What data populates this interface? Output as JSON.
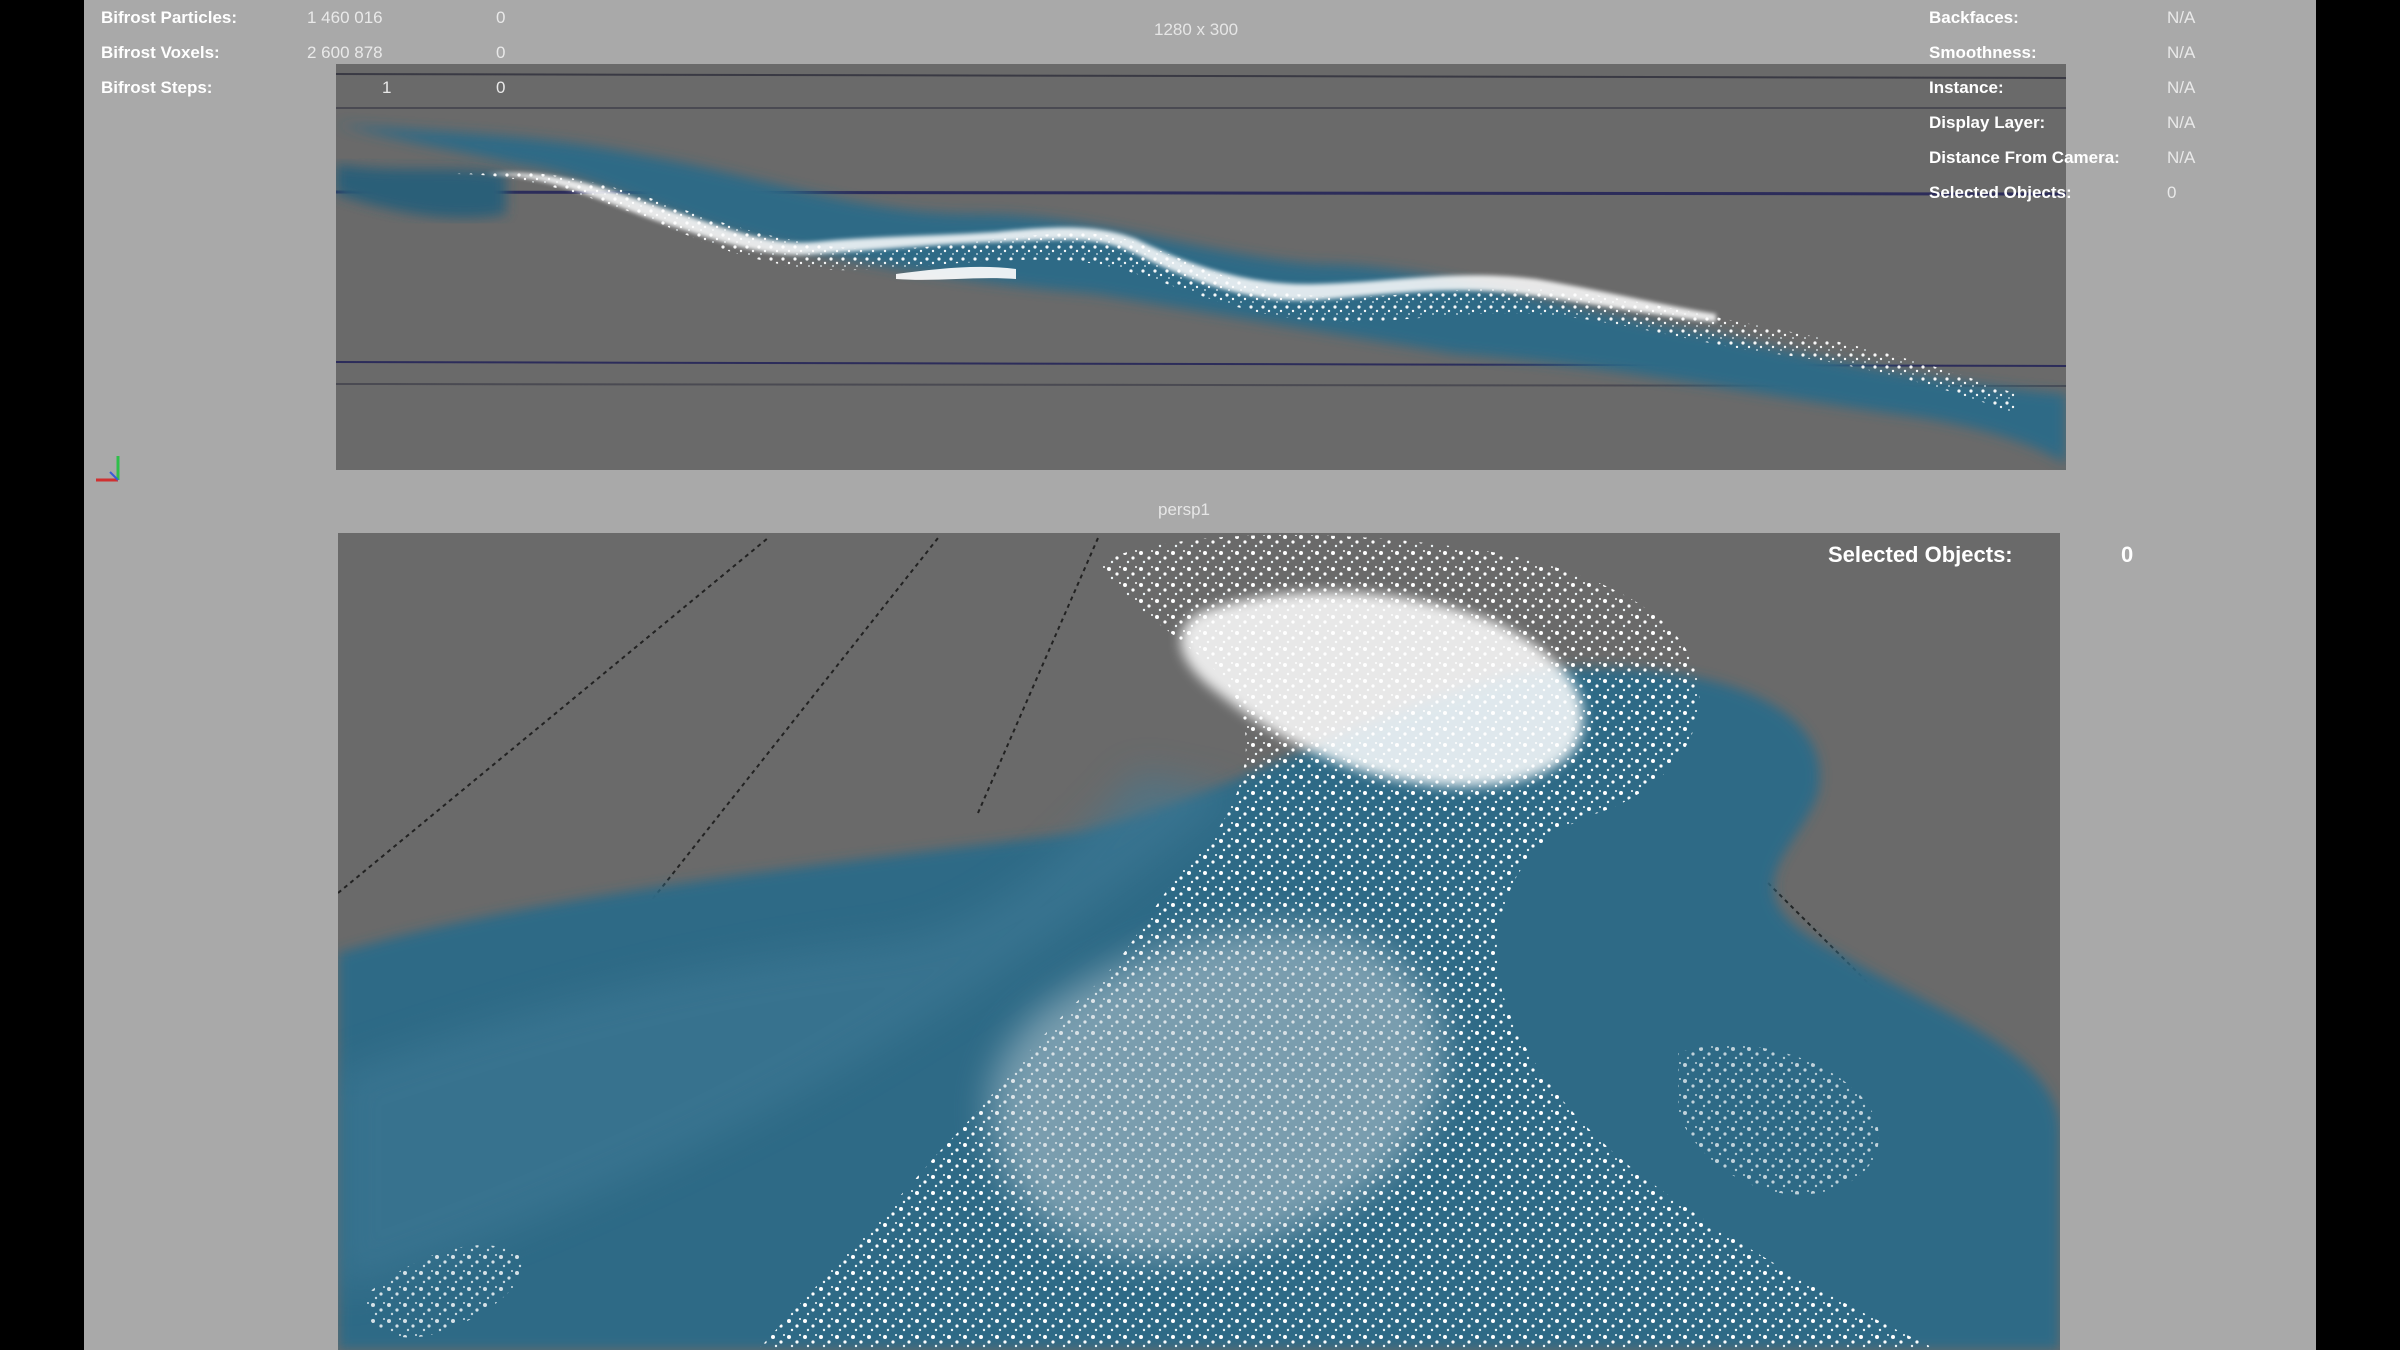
{
  "hud_left": [
    {
      "label": "Bifrost Particles:",
      "value": "1 460 016",
      "extra": "0"
    },
    {
      "label": "Bifrost Voxels:",
      "value": "2 600 878",
      "extra": "0"
    },
    {
      "label": "Bifrost Steps:",
      "value": "1",
      "extra": "0"
    }
  ],
  "top_viewport": {
    "resolution": "1280 x 300"
  },
  "hud_right": [
    {
      "label": "Backfaces:",
      "value": "N/A"
    },
    {
      "label": "Smoothness:",
      "value": "N/A"
    },
    {
      "label": "Instance:",
      "value": "N/A"
    },
    {
      "label": "Display Layer:",
      "value": "N/A"
    },
    {
      "label": "Distance From Camera:",
      "value": "N/A"
    },
    {
      "label": "Selected Objects:",
      "value": "0"
    }
  ],
  "persp_viewport": {
    "camera": "persp1",
    "selected_label": "Selected Objects:",
    "selected_value": "0"
  },
  "colors": {
    "water": "#2e6a86",
    "foam": "#ffffff",
    "viewport_bg": "#6a6a6a",
    "panel_bg": "#a9a9a9"
  }
}
